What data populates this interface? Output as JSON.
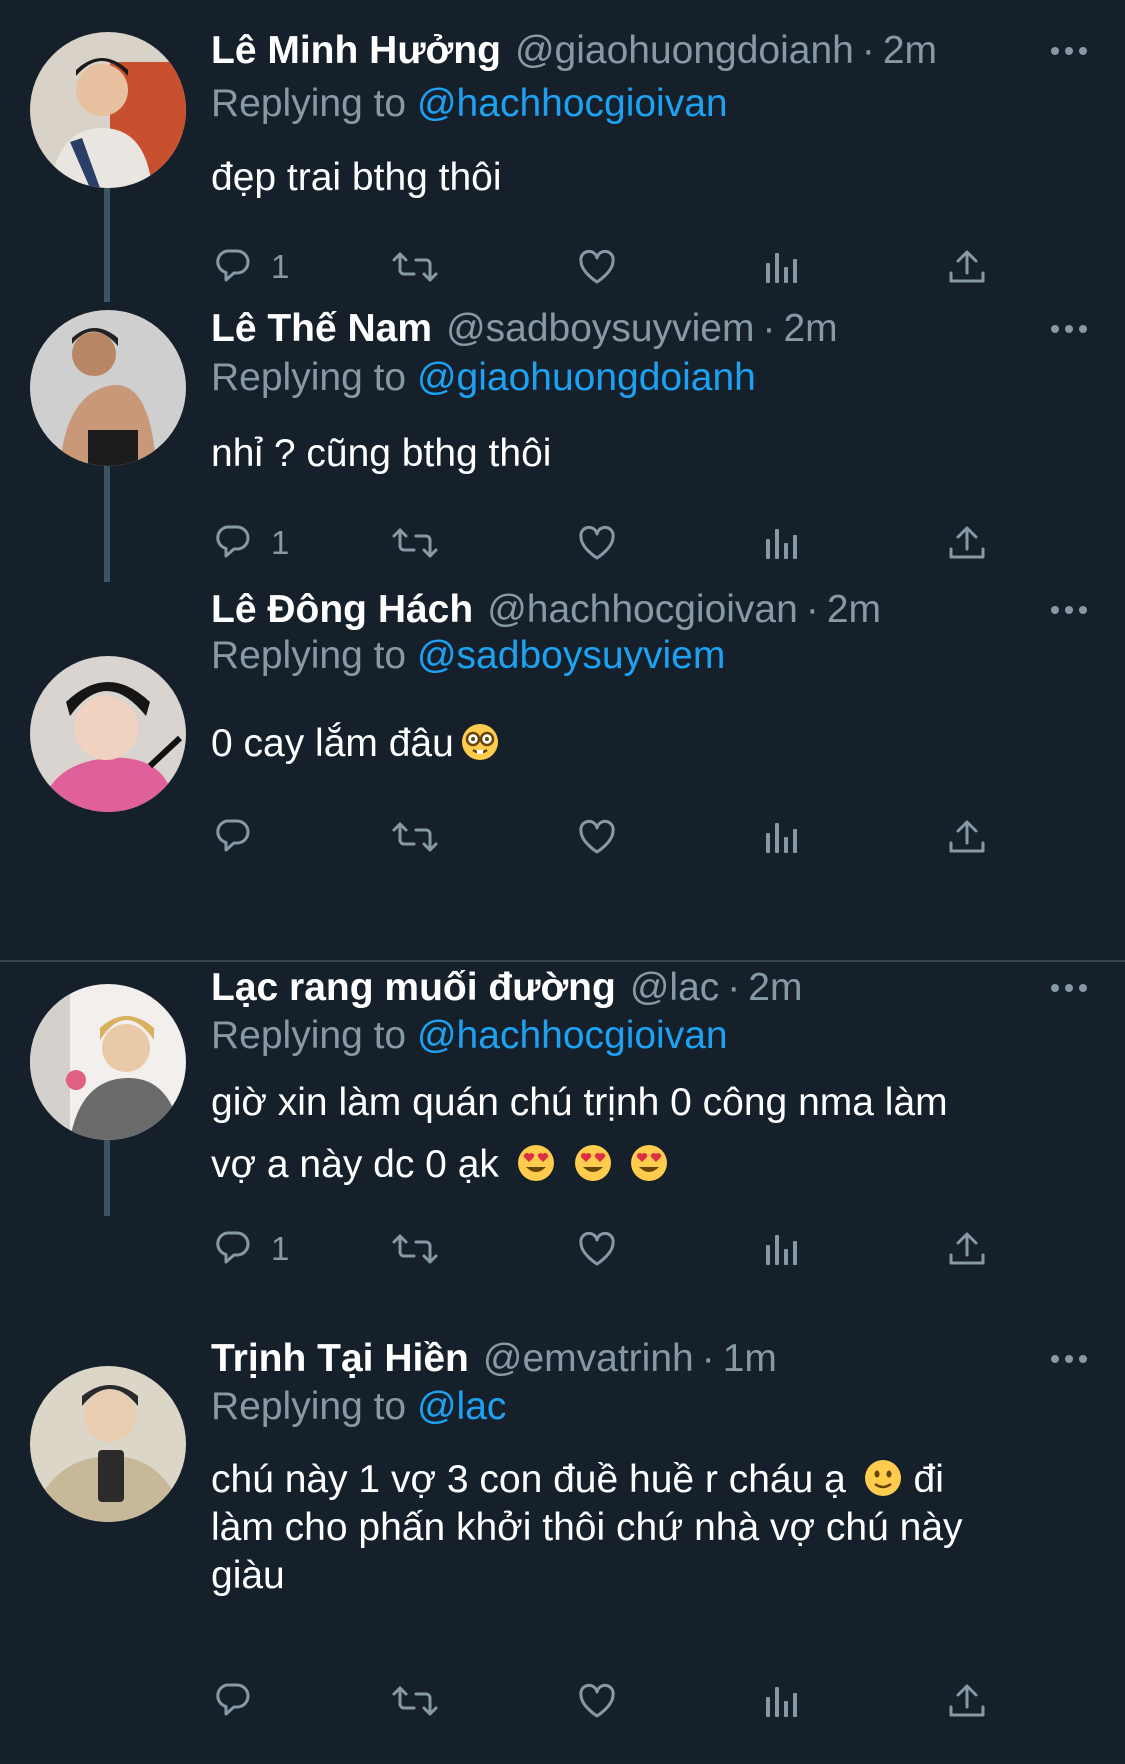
{
  "tweets": [
    {
      "name": "Lê Minh Hưởng",
      "handle": "@giaohuongdoianh",
      "time": "2m",
      "replying_prefix": "Replying to",
      "replying_to": "@hachhocgioivan",
      "text": "đẹp trai bthg thôi",
      "reply_count": "1"
    },
    {
      "name": "Lê Thế Nam",
      "handle": "@sadboysuyviem",
      "time": "2m",
      "replying_prefix": "Replying to",
      "replying_to": "@giaohuongdoianh",
      "text": "nhỉ ? cũng bthg thôi",
      "reply_count": "1"
    },
    {
      "name": "Lê Đông Hách",
      "handle": "@hachhocgioivan",
      "time": "2m",
      "replying_prefix": "Replying to",
      "replying_to": "@sadboysuyviem",
      "text": "0 cay lắm đâu",
      "reply_count": ""
    },
    {
      "name": "Lạc rang muối đường",
      "handle": "@lac",
      "time": "2m",
      "replying_prefix": "Replying to",
      "replying_to": "@hachhocgioivan",
      "text_line1": "giờ xin làm quán chú trịnh 0 công nma làm",
      "text_line2": "vợ a này dc 0 ạk",
      "reply_count": "1"
    },
    {
      "name": "Trịnh Tại Hiền",
      "handle": "@emvatrinh",
      "time": "1m",
      "replying_prefix": "Replying to",
      "replying_to": "@lac",
      "text_line1": "chú này 1 vợ 3 con đuề huề r cháu ạ",
      "text_line1b": "đi",
      "text_line2": "làm cho phấn khởi thôi chứ nhà vợ chú này",
      "text_line3": "giàu",
      "reply_count": ""
    }
  ],
  "separator_dot": "·",
  "icons": [
    "reply-icon",
    "retweet-icon",
    "like-icon",
    "analytics-icon",
    "share-icon",
    "more-icon"
  ],
  "colors": {
    "background": "#15202b",
    "mention": "#1da1f2",
    "secondary": "#8899a6",
    "thread_line": "#3d5466"
  }
}
